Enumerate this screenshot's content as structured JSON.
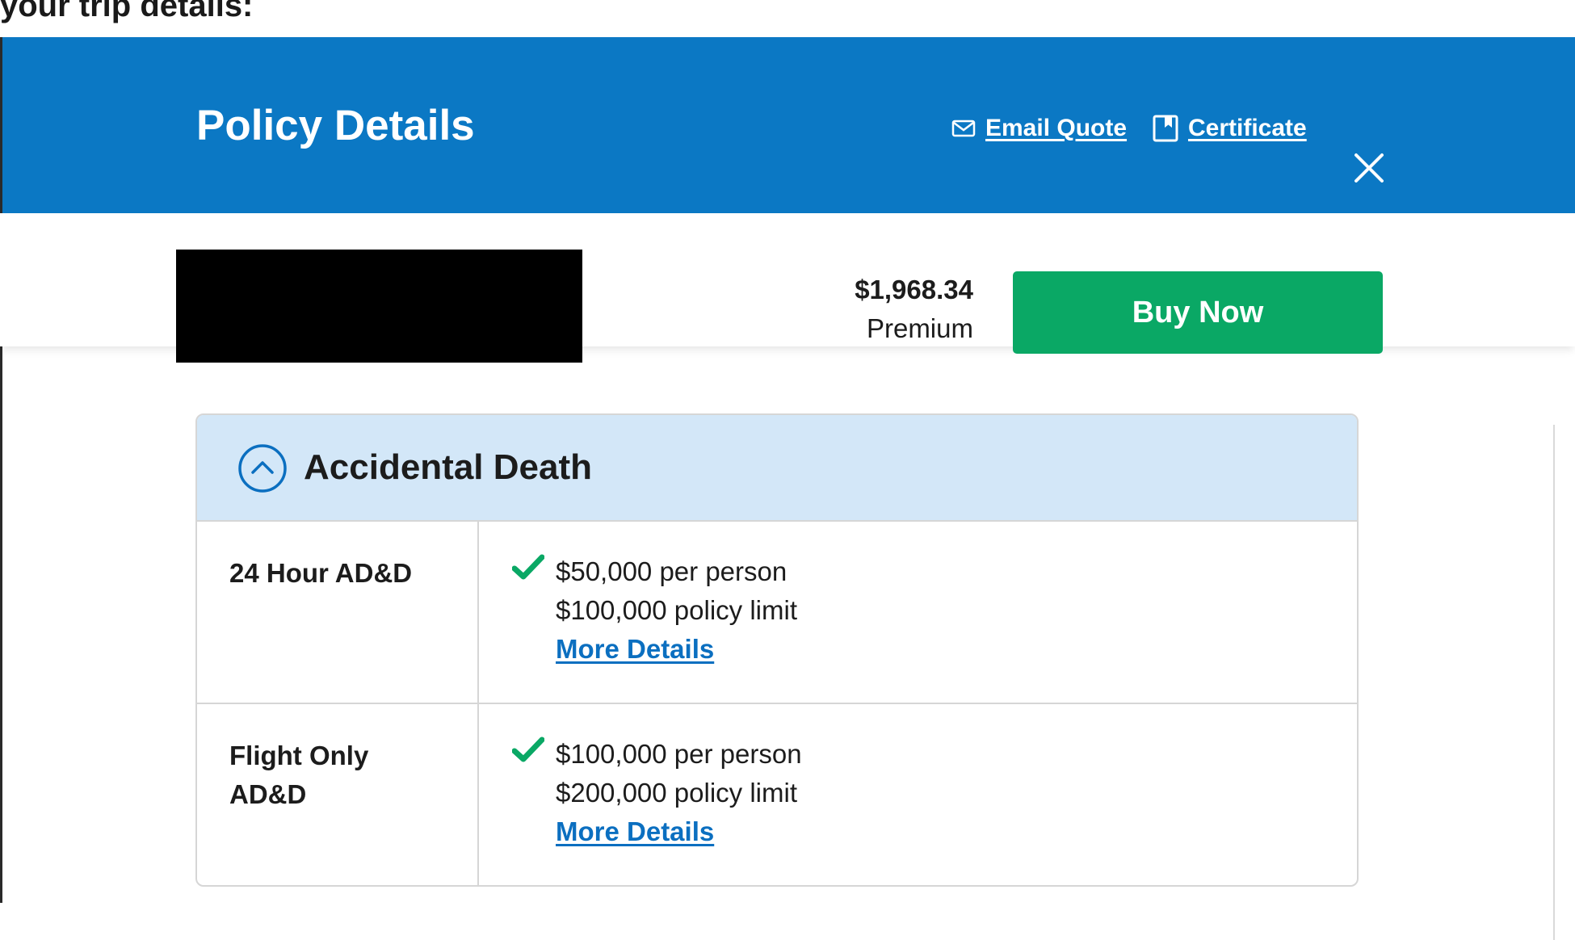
{
  "page": {
    "heading": "your trip details:"
  },
  "modal": {
    "title": "Policy Details",
    "actions": {
      "email_quote": "Email Quote",
      "certificate": "Certificate"
    },
    "icons": [
      "envelope-icon",
      "bookmark-icon",
      "close-icon",
      "chevron-up-icon",
      "check-icon"
    ]
  },
  "purchase": {
    "price": "$1,968.34",
    "price_label": "Premium",
    "buy_label": "Buy Now"
  },
  "section": {
    "title": "Accidental Death",
    "rows": [
      {
        "name": "24 Hour AD&D",
        "lines": [
          "$50,000 per person",
          "$100,000 policy limit"
        ],
        "link": "More Details"
      },
      {
        "name": "Flight Only AD&D",
        "lines": [
          "$100,000 per person",
          "$200,000 policy limit"
        ],
        "link": "More Details"
      }
    ]
  },
  "colors": {
    "header_blue": "#0b78c4",
    "section_bg": "#d3e7f8",
    "buy_green": "#0aa865",
    "check_green": "#0aa865",
    "link_blue": "#0b6fc0"
  }
}
